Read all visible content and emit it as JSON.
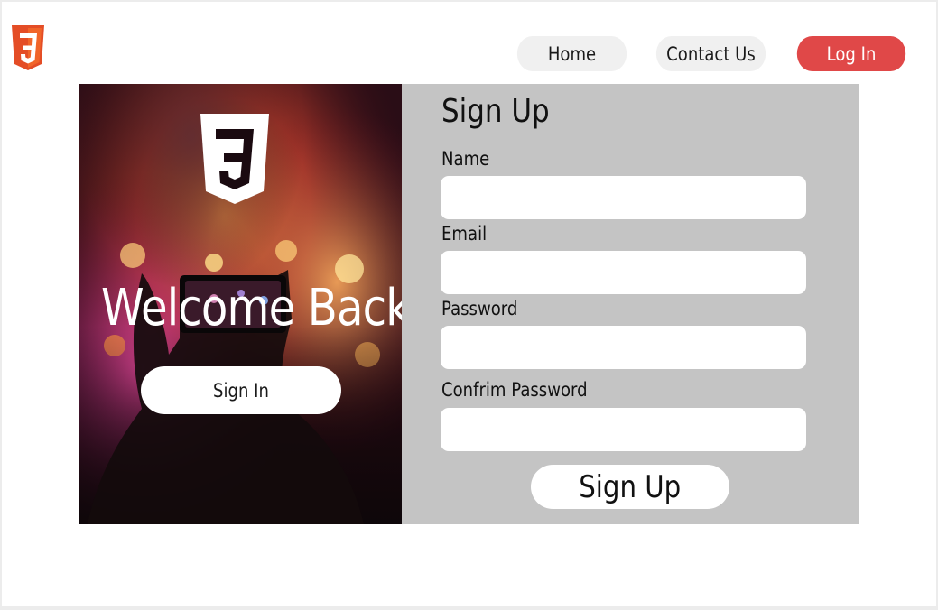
{
  "header": {
    "logo_icon": "css3-logo-icon",
    "nav": {
      "home_label": "Home",
      "contact_label": "Contact Us",
      "login_label": "Log In"
    }
  },
  "hero": {
    "logo_icon": "css3-logo-icon",
    "welcome_text": "Welcome Back",
    "signin_label": "Sign In"
  },
  "form": {
    "title": "Sign Up",
    "fields": {
      "name_label": "Name",
      "name_value": "",
      "email_label": "Email",
      "email_value": "",
      "password_label": "Password",
      "password_value": "",
      "confirm_label": "Confrim Password",
      "confirm_value": ""
    },
    "submit_label": "Sign Up"
  },
  "colors": {
    "accent": "#e04848",
    "panel": "#c4c4c4",
    "nav_bg": "#f0f0f0",
    "logo_red": "#e44d26"
  }
}
